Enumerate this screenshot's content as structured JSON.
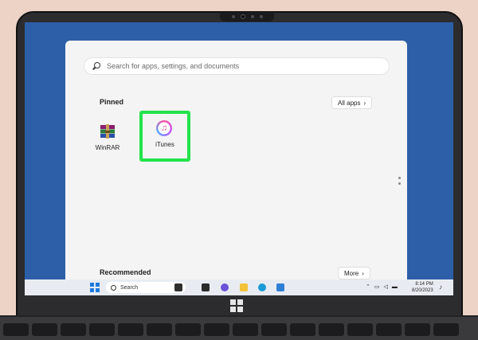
{
  "start_menu": {
    "search_placeholder": "Search for apps, settings, and documents",
    "pinned_label": "Pinned",
    "all_apps_label": "All apps",
    "pinned_apps": [
      {
        "name": "WinRAR",
        "icon": "winrar-icon"
      },
      {
        "name": "iTunes",
        "icon": "itunes-icon",
        "highlighted": true
      }
    ],
    "recommended_label": "Recommended",
    "more_label": "More"
  },
  "taskbar": {
    "search_label": "Search",
    "clock_time": "8:14 PM",
    "clock_date": "8/20/2023",
    "icons": [
      "start-icon",
      "search-icon",
      "widgets-icon",
      "task-view-icon",
      "chat-icon",
      "file-explorer-icon",
      "edge-icon",
      "store-icon"
    ]
  },
  "colors": {
    "accent_highlight": "#23e34b",
    "screen_wallpaper": "#2d5fa8",
    "start_menu_bg": "#f4f4f4"
  }
}
